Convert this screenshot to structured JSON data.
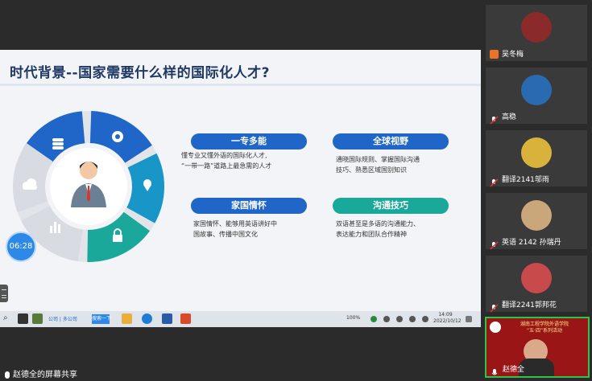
{
  "slide": {
    "title": "时代背景--国家需要什么样的国际化人才?",
    "items": [
      {
        "heading": "一专多能",
        "lines": [
          "懂专业又懂外语的国际化人才,",
          "“一带一路”道路上最急需的人才"
        ]
      },
      {
        "heading": "全球视野",
        "lines": [
          "通晓国际规则、掌握国际沟通",
          "技巧、熟悉区域国别知识"
        ]
      },
      {
        "heading": "家国情怀",
        "lines": [
          "家国情怀、能够用英语讲好中",
          "国故事、传播中国文化"
        ]
      },
      {
        "heading": "沟通技巧",
        "lines": [
          "双语甚至是多语的沟通能力、",
          "表达能力和团队合作精神"
        ]
      }
    ],
    "timer": "06:28"
  },
  "taskbar": {
    "search_hint": "公司 | 多公司",
    "task_label": "搜索一下",
    "battery": "100%",
    "time": "14:09",
    "date": "2022/10/12"
  },
  "share_label": "赵德全的屏幕共享",
  "participants": [
    {
      "name": "吴冬梅",
      "color": "#8a2a2a"
    },
    {
      "name": "高稳",
      "color": "#2a6ab0"
    },
    {
      "name": "翻译2141邬雨",
      "color": "#d8b23a"
    },
    {
      "name": "英语 2142 孙瑞丹",
      "color": "#c9a77a"
    },
    {
      "name": "翻译2241郭邦花",
      "color": "#c84a4a"
    },
    {
      "name": "赵德全",
      "color": "#b01818",
      "banner": [
        "湖南工程学院外语学院",
        "“五·四”系列活动"
      ]
    }
  ]
}
